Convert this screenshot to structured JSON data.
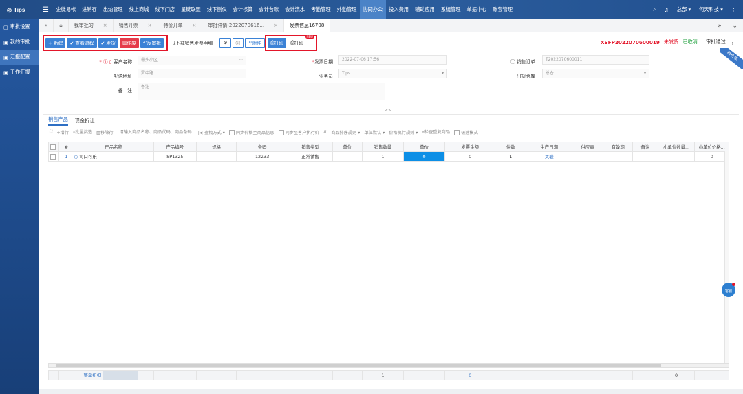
{
  "topbar": {
    "logo": "Tips",
    "nav": [
      "企微易帐",
      "进销存",
      "出纳管理",
      "线上商城",
      "线下门店",
      "星链联盟",
      "线下侧仪",
      "会计核算",
      "会计台账",
      "会计流水",
      "考勤管理",
      "外勤管理",
      "协同办公",
      "投入费用",
      "辅助应用",
      "系统管理",
      "单据中心",
      "账套管理"
    ],
    "active_nav": "协同办公",
    "user": "总部 ▾",
    "company": "何天科技 ▾"
  },
  "sidebar": {
    "items": [
      {
        "label": "审批设置"
      },
      {
        "label": "我的审批"
      },
      {
        "label": "汇报配置"
      },
      {
        "label": "工作汇报"
      }
    ]
  },
  "tabs": [
    "我审批的",
    "销售开票",
    "特价开单",
    "审批详情-2022070616...",
    "发票信息16708"
  ],
  "toolbar": {
    "new": "+ 新建",
    "flow": "✔ 查看流程",
    "ship": "✔ 发货",
    "void": "作废",
    "unapprove": "反审批",
    "download": "下载销售发票明细",
    "attach": "附件",
    "print1": "打印",
    "print2": "打印",
    "print_badge": "NEW",
    "doc_code": "XSFP2022070600019",
    "ship_status": "未发货",
    "pay_status": "已收清",
    "approve_status": "审批通过",
    "ribbon": "特价单"
  },
  "form": {
    "customer_label": "客户名称",
    "customer_value": "珊头小区",
    "address_label": "配送地址",
    "address_value": "罗中路",
    "remark_label": "备　注",
    "remark_value": "备注",
    "date_label": "发票日期",
    "date_value": "2022-07-06 17:56",
    "sales_label": "业务员",
    "sales_value": "Tips",
    "order_label": "销售订单",
    "order_value": "T2022070600011",
    "warehouse_label": "出货仓库",
    "warehouse_value": "总仓"
  },
  "section": {
    "tab_products": "销售产品",
    "tab_discount": "现金折让",
    "tools": {
      "add_row": "+增行",
      "batch": "批量挑选",
      "del_row": "移除行",
      "search_ph": "请输入商品名称、商品代码、商品条码",
      "find": "查找方式",
      "cb1": "同步价格至商品信息",
      "cb2": "同步至客户执行价",
      "sort": "商品排序规则",
      "unit": "单位默认",
      "price_rule": "价格执行规则",
      "check_dup": "检查重复商品",
      "fast": "极速模式"
    }
  },
  "table": {
    "headers": [
      "#",
      "产品名称",
      "产品编号",
      "规格",
      "条码",
      "销售类型",
      "单位",
      "销售数量",
      "单价",
      "发票金额",
      "件数",
      "生产日期",
      "供应商",
      "有效期",
      "备注",
      "小单位数量...",
      "小单位价格..."
    ],
    "rows": [
      [
        "1",
        "司口可乐",
        "SP1325",
        "",
        "12233",
        "正常销售",
        "",
        "1",
        "0",
        "0",
        "1",
        "关联",
        "",
        "",
        "",
        "",
        "0"
      ]
    ],
    "footer": {
      "label": "整单折扣",
      "qty": "1",
      "amount": "0",
      "small_qty": "0"
    }
  },
  "kefu": "客服"
}
